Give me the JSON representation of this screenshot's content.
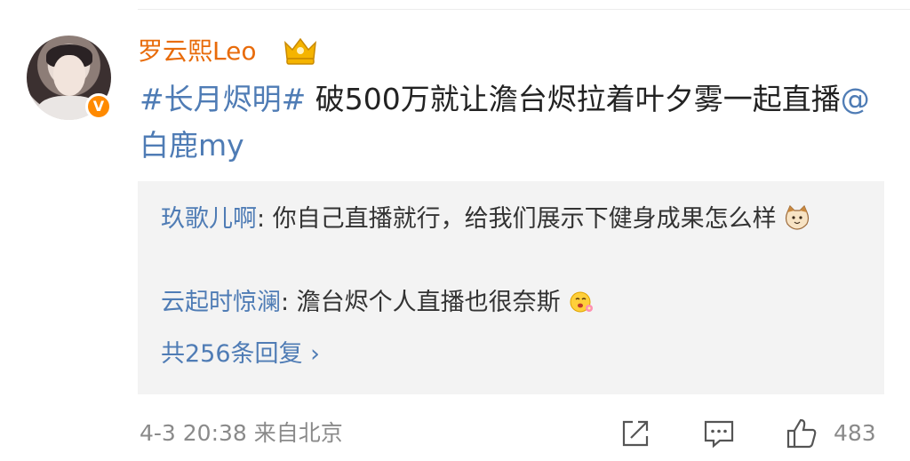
{
  "post": {
    "username": "罗云熙Leo",
    "hashtag": "#长月烬明#",
    "text": " 破500万就让澹台烬拉着叶夕雾一起直播",
    "mention": "@白鹿my",
    "badge": "V"
  },
  "replies": [
    {
      "author": "玖歌儿啊",
      "text": ": 你自己直播就行，给我们展示下健身成果怎么样"
    },
    {
      "author": "云起时惊澜",
      "text": ": 澹台烬个人直播也很奈斯"
    }
  ],
  "more_replies": "共256条回复 ›",
  "footer": {
    "time": "4-3 20:38  来自北京",
    "like_count": "483"
  },
  "icons": {
    "share": "share-icon",
    "comment": "comment-icon",
    "like": "thumbs-up-icon",
    "crown": "crown-badge-icon"
  },
  "colors": {
    "username": "#e86b0a",
    "link": "#4f7cb5",
    "verified": "#ff8a00"
  }
}
